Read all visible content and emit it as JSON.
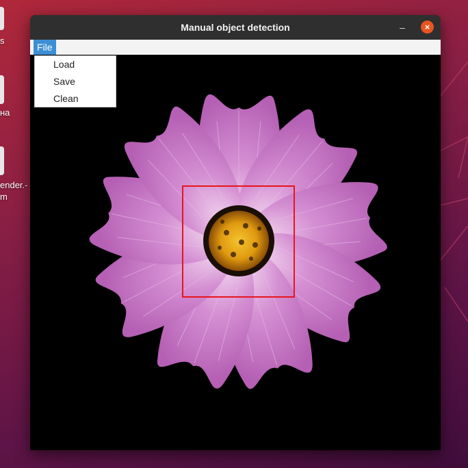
{
  "desktop": {
    "labels": [
      "s",
      "на",
      "ender.-",
      "m"
    ]
  },
  "window": {
    "title": "Manual object detection",
    "minimize_label": "–",
    "close_label": "×"
  },
  "menubar": {
    "file_label": "File",
    "file_menu_items": [
      "Load",
      "Save",
      "Clean"
    ]
  },
  "canvas": {
    "image_description_icon": "flower-image",
    "selection_box_color": "#e8141c"
  },
  "colors": {
    "window_bg": "#000000",
    "titlebar": "#2f2f2f",
    "menu_highlight": "#3d8fd4",
    "close_button": "#e95420",
    "petal": "#c978c9",
    "flower_center": "#e8a217"
  }
}
